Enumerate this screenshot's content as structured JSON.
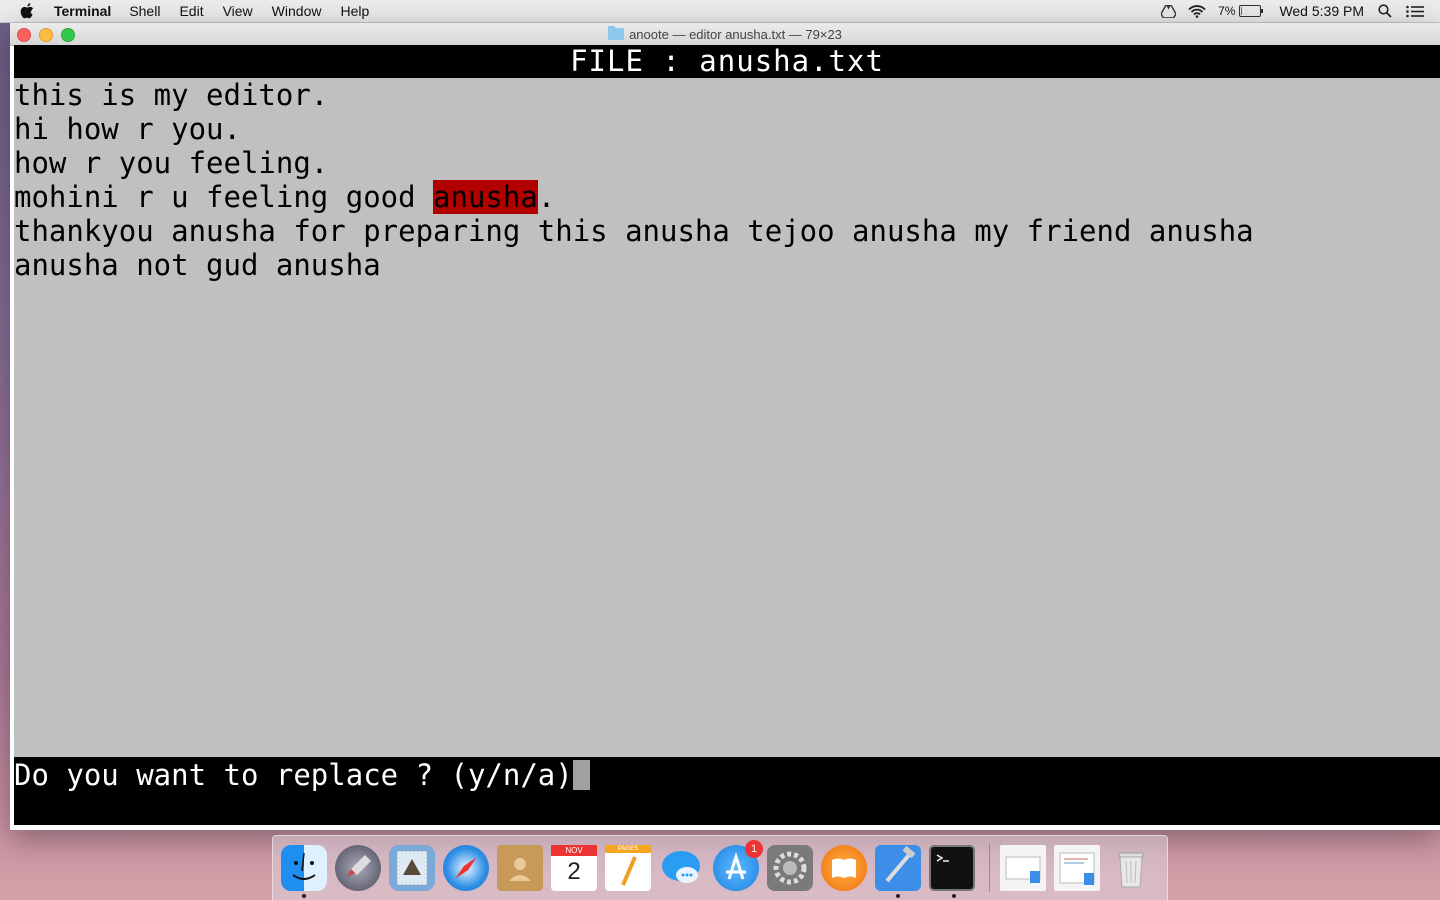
{
  "menubar": {
    "app_name": "Terminal",
    "items": [
      "Shell",
      "Edit",
      "View",
      "Window",
      "Help"
    ],
    "battery_percent": "7%",
    "battery_level": 0.07,
    "clock": "Wed 5:39 PM"
  },
  "window": {
    "title": "anoote — editor anusha.txt — 79×23"
  },
  "terminal": {
    "header": "FILE : anusha.txt",
    "lines": [
      {
        "before": "this is my editor.",
        "match": "",
        "after": ""
      },
      {
        "before": "hi how r you.",
        "match": "",
        "after": ""
      },
      {
        "before": "how r you feeling.",
        "match": "",
        "after": ""
      },
      {
        "before": "mohini r u feeling good ",
        "match": "anusha",
        "after": "."
      },
      {
        "before": "thankyou anusha for preparing this anusha tejoo anusha my friend anusha",
        "match": "",
        "after": ""
      },
      {
        "before": "anusha not gud anusha",
        "match": "",
        "after": ""
      }
    ],
    "prompt": "Do you want to replace ? (y/n/a)",
    "highlight_color": "#b00000",
    "editor_bg": "#c0c0c0"
  },
  "dock": {
    "items": [
      {
        "name": "finder-icon",
        "running": true
      },
      {
        "name": "launchpad-icon",
        "running": false
      },
      {
        "name": "mail-icon",
        "running": false
      },
      {
        "name": "safari-icon",
        "running": false
      },
      {
        "name": "contacts-icon",
        "running": false
      },
      {
        "name": "calendar-icon",
        "running": false,
        "month": "NOV",
        "day": "2"
      },
      {
        "name": "pages-icon",
        "running": false,
        "label": "PAGES"
      },
      {
        "name": "messages-icon",
        "running": false
      },
      {
        "name": "app-store-icon",
        "running": false,
        "badge": "1"
      },
      {
        "name": "system-preferences-icon",
        "running": false
      },
      {
        "name": "ibooks-icon",
        "running": false
      },
      {
        "name": "xcode-icon",
        "running": true
      },
      {
        "name": "terminal-icon",
        "running": true
      }
    ],
    "trailing": [
      {
        "name": "document-stack-icon"
      },
      {
        "name": "downloads-stack-icon"
      },
      {
        "name": "trash-icon"
      }
    ]
  }
}
